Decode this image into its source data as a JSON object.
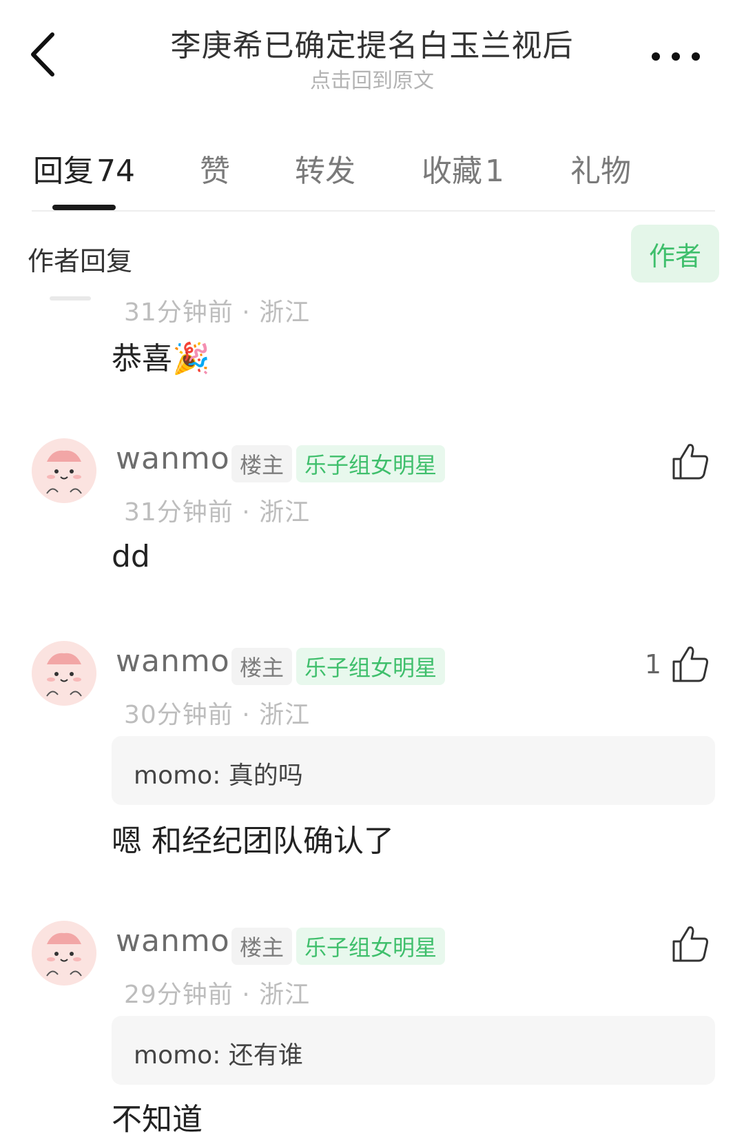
{
  "header": {
    "title": "李庚希已确定提名白玉兰视后",
    "subtitle": "点击回到原文"
  },
  "tabs": [
    {
      "label": "回复",
      "count": "74"
    },
    {
      "label": "赞",
      "count": ""
    },
    {
      "label": "转发",
      "count": ""
    },
    {
      "label": "收藏",
      "count": "1"
    },
    {
      "label": "礼物",
      "count": ""
    }
  ],
  "author_section": {
    "label": "作者回复",
    "badge": "作者"
  },
  "comments": [
    {
      "meta": "31分钟前 · 浙江",
      "text": "恭喜🎉"
    },
    {
      "name": "wanmo",
      "op_tag": "楼主",
      "title_tag": "乐子组女明星",
      "meta": "31分钟前 · 浙江",
      "text": "dd",
      "likes": ""
    },
    {
      "name": "wanmo",
      "op_tag": "楼主",
      "title_tag": "乐子组女明星",
      "meta": "30分钟前 · 浙江",
      "quote": "momo: 真的吗",
      "text": "嗯 和经纪团队确认了",
      "likes": "1"
    },
    {
      "name": "wanmo",
      "op_tag": "楼主",
      "title_tag": "乐子组女明星",
      "meta": "29分钟前 · 浙江",
      "quote": "momo: 还有谁",
      "text": "不知道",
      "likes": ""
    }
  ],
  "icons": {
    "back": "chevron-left-icon",
    "more": "more-horizontal-icon",
    "like": "thumbs-up-icon"
  },
  "colors": {
    "accent_green": "#3fbf6c",
    "badge_bg": "#e4f6e9"
  }
}
